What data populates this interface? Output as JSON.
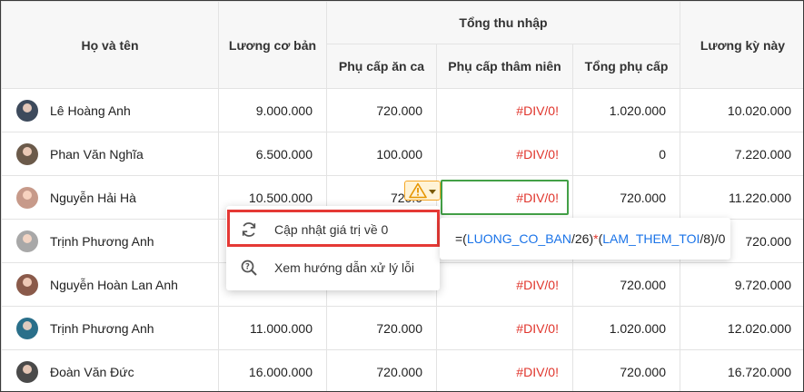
{
  "table": {
    "headers": {
      "name": "Họ và tên",
      "base_salary": "Lương cơ bản",
      "group_income": "Tổng thu nhập",
      "meal_allowance": "Phụ cấp ăn ca",
      "seniority_allowance": "Phụ cấp thâm niên",
      "total_allowance": "Tổng phụ cấp",
      "period_salary": "Lương kỳ này"
    },
    "rows": [
      {
        "name": "Lê Hoàng Anh",
        "base": "9.000.000",
        "meal": "720.000",
        "seniority": "#DIV/0!",
        "total": "1.020.000",
        "period": "10.020.000",
        "avatar_color": "#3d4a5c"
      },
      {
        "name": "Phan Văn Nghĩa",
        "base": "6.500.000",
        "meal": "100.000",
        "seniority": "#DIV/0!",
        "total": "0",
        "period": "7.220.000",
        "avatar_color": "#6b5a4a"
      },
      {
        "name": "Nguyễn Hải Hà",
        "base": "10.500.000",
        "meal": "720.0",
        "seniority": "#DIV/0!",
        "total": "720.000",
        "period": "11.220.000",
        "avatar_color": "#c79a8a"
      },
      {
        "name": "Trịnh Phương Anh",
        "base": "",
        "meal": "",
        "seniority": "",
        "total": "",
        "period": "720.000",
        "avatar_color": "#a8a8a8"
      },
      {
        "name": "Nguyễn Hoàn Lan Anh",
        "base": "",
        "meal": "",
        "seniority": "#DIV/0!",
        "total": "720.000",
        "period": "9.720.000",
        "avatar_color": "#8a5a4a"
      },
      {
        "name": "Trịnh Phương Anh",
        "base": "11.000.000",
        "meal": "720.000",
        "seniority": "#DIV/0!",
        "total": "1.020.000",
        "period": "12.020.000",
        "avatar_color": "#2a6f8a"
      },
      {
        "name": "Đoàn Văn Đức",
        "base": "16.000.000",
        "meal": "720.000",
        "seniority": "#DIV/0!",
        "total": "720.000",
        "period": "16.720.000",
        "avatar_color": "#4a4a4a"
      }
    ]
  },
  "error_menu": {
    "items": [
      {
        "label": "Cập nhật giá trị về 0",
        "icon": "refresh-icon"
      },
      {
        "label": "Xem hướng dẫn xử lý lỗi",
        "icon": "search-help-icon"
      }
    ]
  },
  "formula_tooltip": {
    "eq": "=(",
    "ref1": "LUONG_CO_BAN",
    "part2": "/26)",
    "op": "*",
    "part3": "(",
    "ref2": "LAM_THEM_TOI",
    "part4": "/8)/0"
  },
  "colors": {
    "error_text": "#e0342b",
    "focus_border": "#43a047",
    "highlight_border": "#e53935",
    "warning_fill": "#fff3d6",
    "warning_border": "#f5a623",
    "formula_ref": "#1a73e8"
  }
}
